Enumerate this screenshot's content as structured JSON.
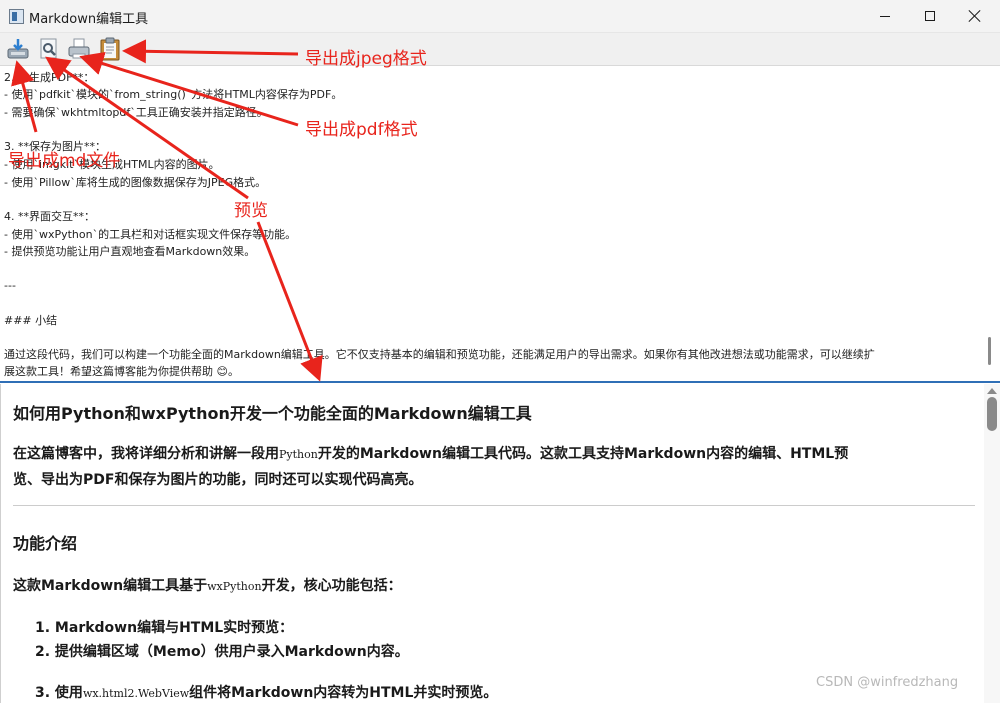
{
  "window": {
    "title": "Markdown编辑工具",
    "controls": {
      "minimize": "minimize",
      "maximize": "maximize",
      "close": "close"
    }
  },
  "toolbar": {
    "buttons": [
      {
        "icon": "save-md-icon"
      },
      {
        "icon": "preview-icon"
      },
      {
        "icon": "export-pdf-icon"
      },
      {
        "icon": "export-jpeg-icon"
      }
    ]
  },
  "editor": {
    "lines": [
      "2. **生成PDF**：",
      "  - 使用`pdfkit`模块的`from_string()`方法将HTML内容保存为PDF。",
      "  - 需要确保`wkhtmltopdf`工具正确安装并指定路径。",
      "3. **保存为图片**：",
      "  - 使用`imgkit`模块生成HTML内容的图片。",
      "  - 使用`Pillow`库将生成的图像数据保存为JPEG格式。",
      "4. **界面交互**：",
      "  - 使用`wxPython`的工具栏和对话框实现文件保存等功能。",
      "  - 提供预览功能让用户直观地查看Markdown效果。",
      "---",
      "### 小结",
      "通过这段代码，我们可以构建一个功能全面的Markdown编辑工具。它不仅支持基本的编辑和预览功能，还能满足用户的导出需求。如果你有其他改进想法或功能需求，可以继续扩",
      "展这款工具！希望这篇博客能为你提供帮助 😊。"
    ]
  },
  "preview": {
    "h1": "如何用Python和wxPython开发一个功能全面的Markdown编辑工具",
    "intro_a": "在这篇博客中，我将详细分析和讲解一段用",
    "intro_code": "Python",
    "intro_b": "开发的Markdown编辑工具代码。这款工具支持Markdown内容的编辑、HTML预",
    "intro_line2": "览、导出为PDF和保存为图片的功能，同时还可以实现代码高亮。",
    "h2": "功能介绍",
    "p_a": "这款Markdown编辑工具基于",
    "p_code": "wxPython",
    "p_b": "开发，核心功能包括：",
    "list": [
      "1. Markdown编辑与HTML实时预览：",
      "2. 提供编辑区域（Memo）供用户录入Markdown内容。"
    ],
    "li3_a": "3. 使用",
    "li3_code": "wx.html2.WebView",
    "li3_b": "组件将Markdown内容转为HTML并实时预览。"
  },
  "annotations": {
    "export_jpeg": "导出成jpeg格式",
    "export_pdf": "导出成pdf格式",
    "export_md": "导出成md文件",
    "preview": "预览",
    "color": "#e8241c"
  },
  "watermark": "CSDN @winfredzhang",
  "colors": {
    "splitter": "#2f6fb6",
    "annotation": "#e8241c"
  }
}
